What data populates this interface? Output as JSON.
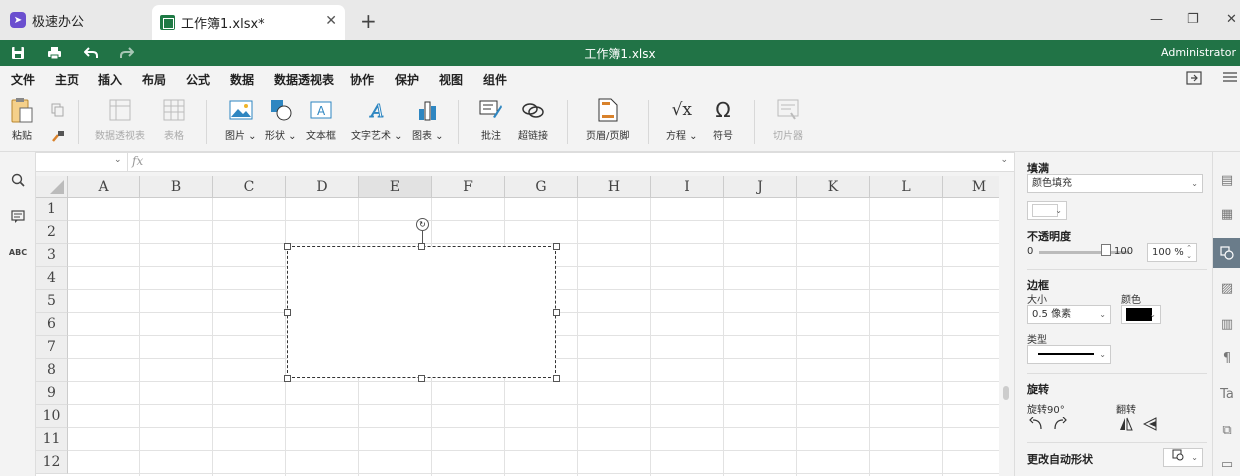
{
  "app": {
    "name": "极速办公"
  },
  "tab": {
    "title": "工作簿1.xlsx*",
    "close": "✕",
    "new": "+"
  },
  "window": {
    "minimize": "—",
    "restore": "❐",
    "close": "✕"
  },
  "quickbar": {
    "doc_title": "工作簿1.xlsx",
    "user": "Administrator"
  },
  "menu": {
    "items": [
      "文件",
      "主页",
      "插入",
      "布局",
      "公式",
      "数据",
      "数据透视表",
      "协作",
      "保护",
      "视图",
      "组件"
    ],
    "active": "插入"
  },
  "ribbon": {
    "paste": "粘贴",
    "pivot": "数据透视表",
    "table": "表格",
    "picture": "图片",
    "shape": "形状",
    "textbox": "文本框",
    "wordart": "文字艺术",
    "chart": "图表",
    "comment": "批注",
    "hyperlink": "超链接",
    "headerfooter": "页眉/页脚",
    "equation": "方程",
    "symbol": "符号",
    "slicer": "切片器"
  },
  "formula": {
    "name_box": "",
    "fx": "fx",
    "value": ""
  },
  "grid": {
    "columns": [
      "A",
      "B",
      "C",
      "D",
      "E",
      "F",
      "G",
      "H",
      "I",
      "J",
      "K",
      "L",
      "M"
    ],
    "rows": [
      "1",
      "2",
      "3",
      "4",
      "5",
      "6",
      "7",
      "8",
      "9",
      "10",
      "11",
      "12"
    ],
    "selected_column": "E"
  },
  "panel": {
    "fill_label": "填满",
    "fill_type": "颜色填充",
    "opacity_label": "不透明度",
    "opacity_min": "0",
    "opacity_max": "100",
    "opacity_value": "100 %",
    "opacity_level": 1.0,
    "border_label": "边框",
    "size_label": "大小",
    "size_value": "0.5 像素",
    "color_label": "颜色",
    "border_color": "#000000",
    "type_label": "类型",
    "rotation_label": "旋转",
    "rotate90_label": "旋转90°",
    "flip_label": "翻转",
    "autoshape_label": "更改自动形状"
  },
  "colors": {
    "accent": "#217346",
    "titlebar": "#e9e9e9",
    "panel_active": "#6a7c8a"
  }
}
